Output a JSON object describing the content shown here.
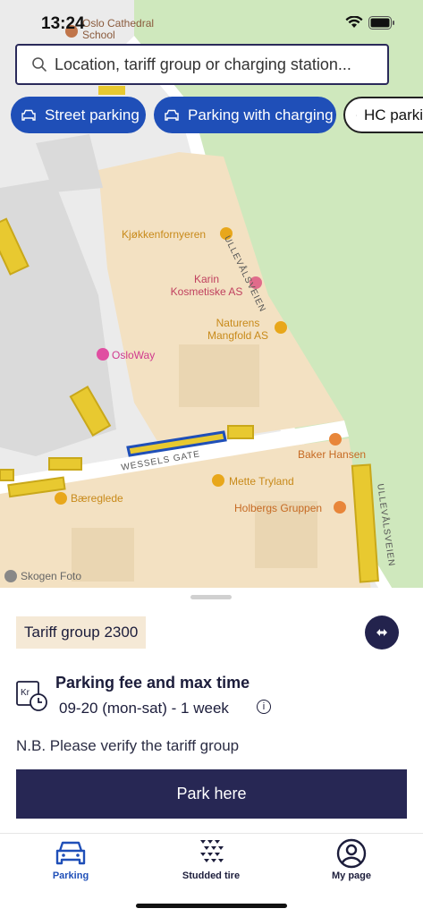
{
  "status_bar": {
    "time": "13:24"
  },
  "search": {
    "placeholder": "Location, tariff group or charging station..."
  },
  "filters": [
    {
      "label": "Street parking",
      "icon": "car-icon",
      "active": true
    },
    {
      "label": "Parking with charging",
      "icon": "car-charging-icon",
      "active": true
    },
    {
      "label": "HC parking",
      "icon": "wheelchair-icon",
      "active": false
    }
  ],
  "map": {
    "labels": {
      "cathedral": "Oslo Cathedral School",
      "kjokken": "Kjøkkenfornyeren",
      "karin": "Karin Kosmetiske AS",
      "naturens": "Naturens Mangfold AS",
      "osloway": "OsloWay",
      "ullevalsveien_top": "ULLEVÅLSVEIEN",
      "wessels": "WESSELS GATE",
      "baker": "Baker Hansen",
      "mette": "Mette Tryland",
      "baereglede": "Bæreglede",
      "holbergs": "Holbergs Gruppen",
      "ullevalsveien_bottom": "ULLEVÅLSVEIEN",
      "skogen": "Skogen Foto"
    },
    "colors": {
      "park": "#cfe8bd",
      "building": "#f3e1c2",
      "road": "#ffffff",
      "highlight": "#1f4fb8",
      "zone": "#e8c930"
    }
  },
  "sheet": {
    "tariff_group": "Tariff group 2300",
    "fee_title": "Parking fee and max time",
    "fee_hours": "09-20 (mon-sat) - 1 week",
    "note": "N.B. Please verify the tariff group",
    "park_button": "Park here"
  },
  "tabbar": {
    "tabs": [
      {
        "label": "Parking",
        "icon": "car-icon",
        "active": true
      },
      {
        "label": "Studded tire",
        "icon": "studded-tire-icon",
        "active": false
      },
      {
        "label": "My page",
        "icon": "user-icon",
        "active": false
      }
    ]
  },
  "colors": {
    "primary": "#1f4fb8",
    "dark": "#272754",
    "badge": "#f5e9d6"
  }
}
